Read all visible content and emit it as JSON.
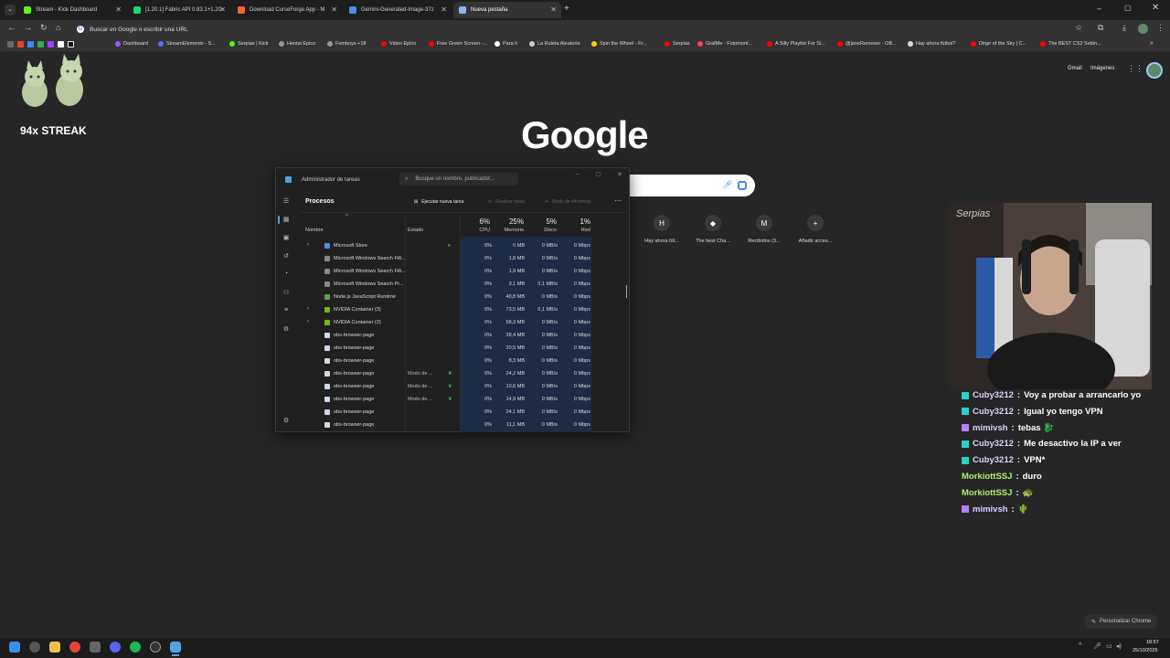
{
  "browser": {
    "tabs": [
      {
        "title": "Stream - Kick Dashboard",
        "color": "#53fc18"
      },
      {
        "title": "[1.20.1] Fabric API 0.83.1+1.20.",
        "color": "#1bd96a"
      },
      {
        "title": "Download CurseForge App - M",
        "color": "#f16436"
      },
      {
        "title": "Gemini-Generated-Image-37z",
        "color": "#4a90e2"
      },
      {
        "title": "Nueva pestaña",
        "color": "#8ab4f8"
      }
    ],
    "omnibox_placeholder": "Buscar en Google o escribir una URL",
    "bookmarks": [
      {
        "label": "Dashboard",
        "color": "#9b59ff"
      },
      {
        "label": "StreamElements - S...",
        "color": "#5c6cff"
      },
      {
        "label": "Serpias | Kick",
        "color": "#53fc18"
      },
      {
        "label": "Hentai Epico",
        "color": "#999"
      },
      {
        "label": "Femboys +18",
        "color": "#999"
      },
      {
        "label": "Video Epico",
        "color": "#ff0000"
      },
      {
        "label": "Free Green Screen -...",
        "color": "#ff0000"
      },
      {
        "label": "Para ti",
        "color": "#ffffff"
      },
      {
        "label": "La Ruleta Aleatoria",
        "color": "#cccccc"
      },
      {
        "label": "Spin the Wheel - Fr...",
        "color": "#ffcc00"
      },
      {
        "label": "Serpias",
        "color": "#ff0000"
      },
      {
        "label": "GrafMe - Fotomont...",
        "color": "#ff4444"
      },
      {
        "label": "A Silly Playlist For Si...",
        "color": "#ff0000"
      },
      {
        "label": "@janeRemover - OB...",
        "color": "#ff0000"
      },
      {
        "label": "Hay ahora fútbol?",
        "color": "#dddddd"
      },
      {
        "label": "Dirge of the Sky | C...",
        "color": "#ff0000"
      },
      {
        "label": "The BEST CS2 Settin...",
        "color": "#ff0000"
      }
    ]
  },
  "google": {
    "logo": "Google",
    "gmail": "Gmail",
    "images": "Imágenes",
    "shortcuts": [
      {
        "label": "Hay ahora fút...",
        "glyph": "H"
      },
      {
        "label": "The best Cha...",
        "glyph": "◆"
      },
      {
        "label": "Recibidos (3...",
        "glyph": "M"
      },
      {
        "label": "Añadir acces...",
        "glyph": "+"
      }
    ],
    "customize": "Personalizar Chrome"
  },
  "overlay": {
    "streak": "94x STREAK"
  },
  "task_manager": {
    "title": "Administrador de tareas",
    "search_placeholder": "Busque un nombre, publicador...",
    "heading": "Procesos",
    "actions": {
      "new_task": "Ejecutar nueva tarea",
      "end_task": "Finalizar tarea",
      "efficiency": "Modo de eficiencia"
    },
    "columns": {
      "name": "Nombre",
      "status": "Estado",
      "cpu": "CPU",
      "mem": "Memoria",
      "disk": "Disco",
      "net": "Red"
    },
    "totals": {
      "cpu": "6%",
      "mem": "25%",
      "disk": "5%",
      "net": "1%"
    },
    "rows": [
      {
        "name": "Microsoft Store",
        "status": "",
        "status_icon": "pause-icon",
        "expand": true,
        "cpu": "0%",
        "mem": "0 MB",
        "disk": "0 MB/s",
        "net": "0 Mbps",
        "icon_color": "#4a90e2"
      },
      {
        "name": "Microsoft Windows Search Filt...",
        "status": "",
        "expand": false,
        "cpu": "0%",
        "mem": "1,8 MB",
        "disk": "0 MB/s",
        "net": "0 Mbps",
        "icon_color": "#888"
      },
      {
        "name": "Microsoft Windows Search Filt...",
        "status": "",
        "expand": false,
        "cpu": "0%",
        "mem": "1,9 MB",
        "disk": "0 MB/s",
        "net": "0 Mbps",
        "icon_color": "#888"
      },
      {
        "name": "Microsoft Windows Search Pr...",
        "status": "",
        "expand": false,
        "cpu": "0%",
        "mem": "3,1 MB",
        "disk": "0,1 MB/s",
        "net": "0 Mbps",
        "icon_color": "#888"
      },
      {
        "name": "Node.js JavaScript Runtime",
        "status": "",
        "expand": false,
        "cpu": "0%",
        "mem": "40,8 MB",
        "disk": "0 MB/s",
        "net": "0 Mbps",
        "icon_color": "#5fa04e"
      },
      {
        "name": "NVIDIA Container (3)",
        "status": "",
        "expand": true,
        "cpu": "0%",
        "mem": "73,5 MB",
        "disk": "0,1 MB/s",
        "net": "0 Mbps",
        "icon_color": "#76b900"
      },
      {
        "name": "NVIDIA Container (2)",
        "status": "",
        "expand": true,
        "cpu": "0%",
        "mem": "58,3 MB",
        "disk": "0 MB/s",
        "net": "0 Mbps",
        "icon_color": "#76b900"
      },
      {
        "name": "obs-browser-page",
        "status": "",
        "expand": false,
        "cpu": "0%",
        "mem": "28,4 MB",
        "disk": "0 MB/s",
        "net": "0 Mbps",
        "icon_color": "#cfd8e6"
      },
      {
        "name": "obs-browser-page",
        "status": "",
        "expand": false,
        "cpu": "0%",
        "mem": "20,5 MB",
        "disk": "0 MB/s",
        "net": "0 Mbps",
        "icon_color": "#cfd8e6"
      },
      {
        "name": "obs-browser-page",
        "status": "",
        "expand": false,
        "cpu": "0%",
        "mem": "8,3 MB",
        "disk": "0 MB/s",
        "net": "0 Mbps",
        "icon_color": "#cfd8e6"
      },
      {
        "name": "obs-browser-page",
        "status": "Modo de ...",
        "status_icon": "leaf-icon",
        "expand": false,
        "cpu": "0%",
        "mem": "24,2 MB",
        "disk": "0 MB/s",
        "net": "0 Mbps",
        "icon_color": "#cfd8e6"
      },
      {
        "name": "obs-browser-page",
        "status": "Modo de ...",
        "status_icon": "leaf-icon",
        "expand": false,
        "cpu": "0%",
        "mem": "10,6 MB",
        "disk": "0 MB/s",
        "net": "0 Mbps",
        "icon_color": "#cfd8e6"
      },
      {
        "name": "obs-browser-page",
        "status": "Modo de ...",
        "status_icon": "leaf-icon",
        "expand": false,
        "cpu": "0%",
        "mem": "14,9 MB",
        "disk": "0 MB/s",
        "net": "0 Mbps",
        "icon_color": "#cfd8e6"
      },
      {
        "name": "obs-browser-page",
        "status": "",
        "expand": false,
        "cpu": "0%",
        "mem": "24,1 MB",
        "disk": "0 MB/s",
        "net": "0 Mbps",
        "icon_color": "#cfd8e6"
      },
      {
        "name": "obs-browser-page",
        "status": "",
        "expand": false,
        "cpu": "0%",
        "mem": "11,1 MB",
        "disk": "0 MB/s",
        "net": "0 Mbps",
        "icon_color": "#cfd8e6"
      }
    ]
  },
  "webcam": {
    "banner": "Serpias"
  },
  "chat": [
    {
      "user": "Cuby3212",
      "msg": "Voy a probar a arrancarlo yo",
      "user_color": "#dcd0ff",
      "icon_color": "#2ad1c4"
    },
    {
      "user": "Cuby3212",
      "msg": "Igual yo tengo VPN",
      "user_color": "#dcd0ff",
      "icon_color": "#2ad1c4"
    },
    {
      "user": "mimivsh",
      "msg": "tebas 🐉",
      "user_color": "#dcd0ff",
      "icon_color": "#b380ff"
    },
    {
      "user": "Cuby3212",
      "msg": "Me desactivo la IP a ver",
      "user_color": "#dcd0ff",
      "icon_color": "#2ad1c4"
    },
    {
      "user": "Cuby3212",
      "msg": "VPN*",
      "user_color": "#dcd0ff",
      "icon_color": "#2ad1c4"
    },
    {
      "user": "MorkiottSSJ",
      "msg": "duro",
      "user_color": "#a6f26b",
      "icon_color": ""
    },
    {
      "user": "MorkiottSSJ",
      "msg": "🐢",
      "user_color": "#a6f26b",
      "icon_color": ""
    },
    {
      "user": "mimivsh",
      "msg": "🌵",
      "user_color": "#dcd0ff",
      "icon_color": "#b380ff"
    }
  ],
  "taskbar": {
    "time": "18:57",
    "date": "25/10/2025"
  }
}
